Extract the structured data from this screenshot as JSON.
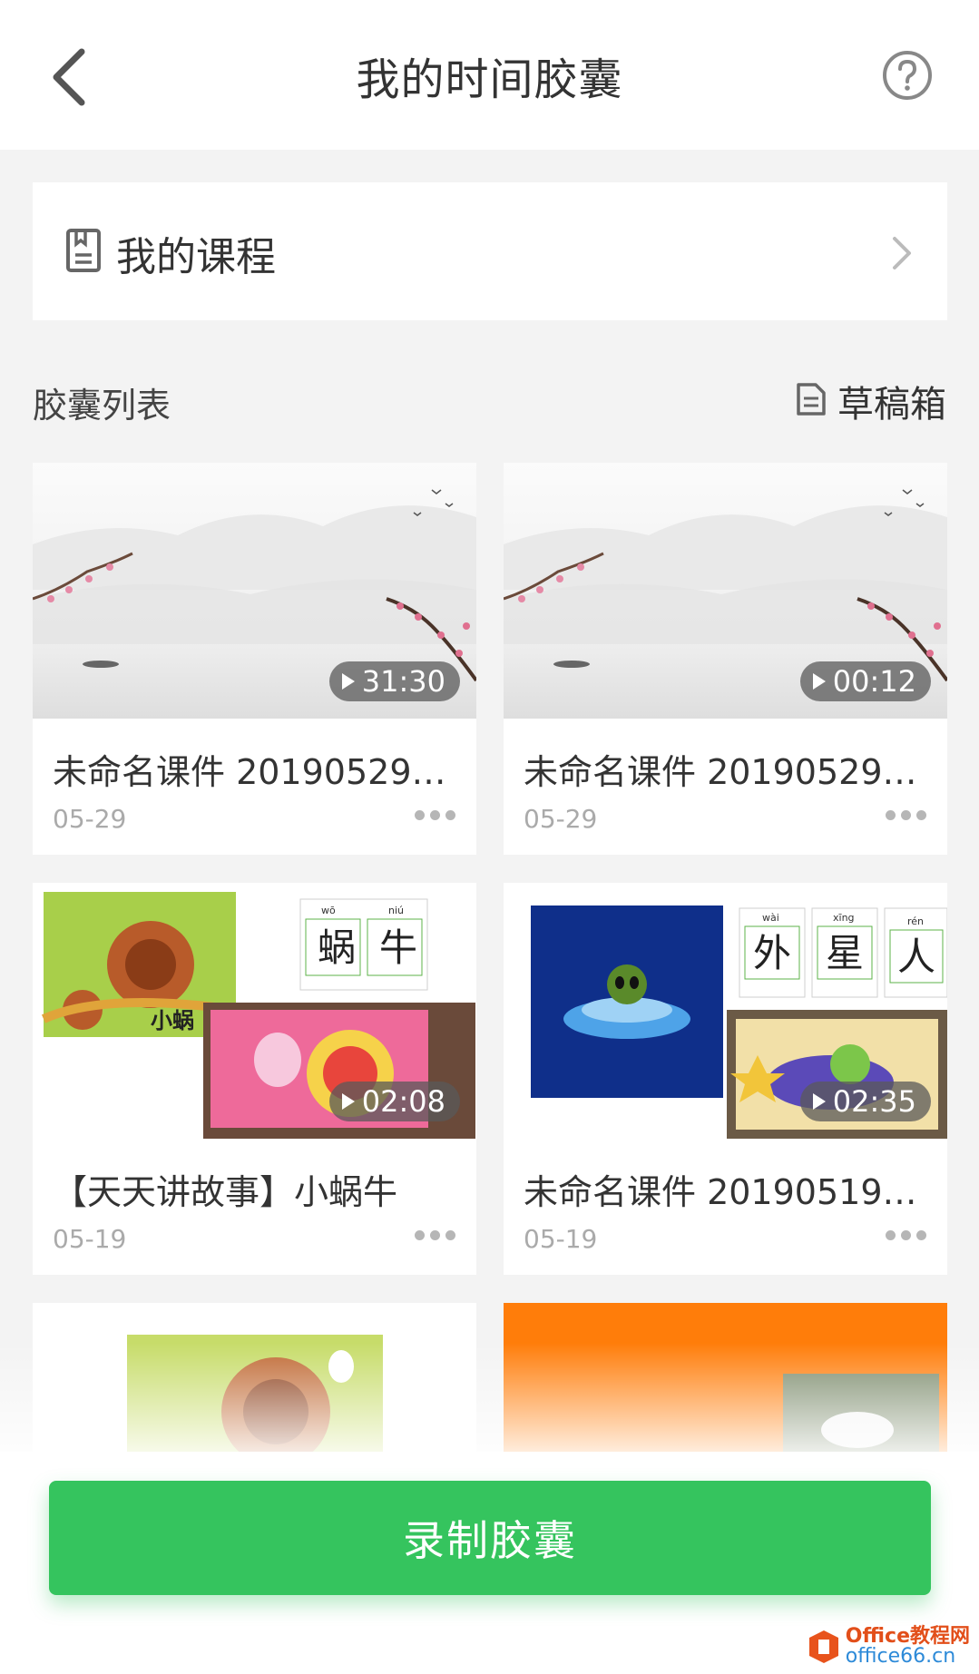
{
  "header": {
    "title": "我的时间胶囊"
  },
  "course": {
    "label": "我的课程"
  },
  "section": {
    "title": "胶囊列表",
    "drafts_label": "草稿箱"
  },
  "capsules": [
    {
      "title": "未命名课件 20190529…",
      "date": "05-29",
      "duration": "31:30"
    },
    {
      "title": "未命名课件 20190529…",
      "date": "05-29",
      "duration": "00:12"
    },
    {
      "title": "【天天讲故事】小蜗牛",
      "date": "05-19",
      "duration": "02:08",
      "thumb_text": "小蜗",
      "chars": [
        {
          "pinyin": "wō",
          "hanzi": "蜗"
        },
        {
          "pinyin": "niú",
          "hanzi": "牛"
        }
      ]
    },
    {
      "title": "未命名课件 20190519…",
      "date": "05-19",
      "duration": "02:35",
      "chars": [
        {
          "pinyin": "wài",
          "hanzi": "外"
        },
        {
          "pinyin": "xīng",
          "hanzi": "星"
        },
        {
          "pinyin": "rén",
          "hanzi": "人"
        }
      ]
    }
  ],
  "actions": {
    "record_label": "录制胶囊"
  },
  "watermark": {
    "line1": "Office教程网",
    "line2": "office66.cn"
  },
  "colors": {
    "accent": "#35c45e",
    "background": "#f3f3f3"
  }
}
